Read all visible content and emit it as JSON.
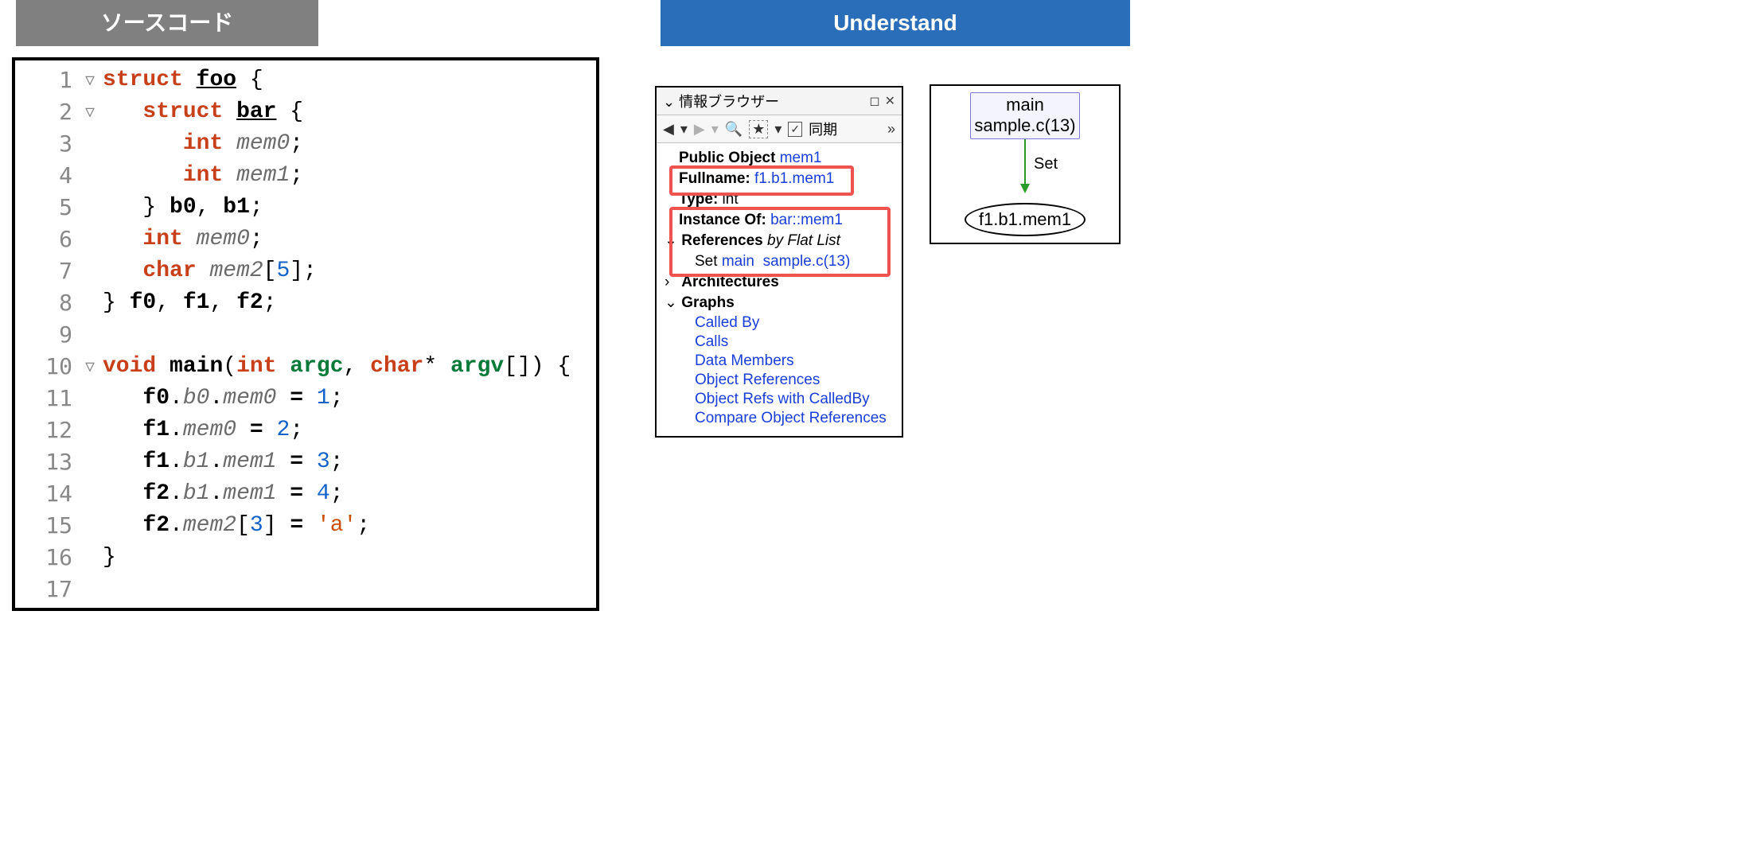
{
  "headers": {
    "source": "ソースコード",
    "understand": "Understand"
  },
  "code": {
    "lines": [
      {
        "n": 1,
        "fold": true,
        "html": "<span class='kw'>struct</span> <span class='decl'>foo</span> <span class='pn'>{</span>"
      },
      {
        "n": 2,
        "fold": true,
        "html": "   <span class='kw'>struct</span> <span class='decl'>bar</span> <span class='pn'>{</span>"
      },
      {
        "n": 3,
        "fold": false,
        "html": "      <span class='kw'>int</span> <span class='mem'>mem0</span><span class='pn'>;</span>"
      },
      {
        "n": 4,
        "fold": false,
        "html": "      <span class='kw'>int</span> <span class='mem'>mem1</span><span class='pn'>;</span>"
      },
      {
        "n": 5,
        "fold": false,
        "html": "   <span class='pn'>}</span> <span class='id'>b0</span><span class='pn'>,</span> <span class='id'>b1</span><span class='pn'>;</span>"
      },
      {
        "n": 6,
        "fold": false,
        "html": "   <span class='kw'>int</span> <span class='mem'>mem0</span><span class='pn'>;</span>"
      },
      {
        "n": 7,
        "fold": false,
        "html": "   <span class='kw'>char</span> <span class='mem'>mem2</span><span class='pn'>[</span><span class='num'>5</span><span class='pn'>];</span>"
      },
      {
        "n": 8,
        "fold": false,
        "html": "<span class='pn'>}</span> <span class='id'>f0</span><span class='pn'>,</span> <span class='id'>f1</span><span class='pn'>,</span> <span class='id'>f2</span><span class='pn'>;</span>"
      },
      {
        "n": 9,
        "fold": false,
        "html": ""
      },
      {
        "n": 10,
        "fold": true,
        "html": "<span class='kw'>void</span> <span class='fn'>main</span><span class='pn'>(</span><span class='kw'>int</span> <span class='type'>argc</span><span class='pn'>,</span> <span class='kw'>char</span><span class='pn'>*</span> <span class='type'>argv</span><span class='pn'>[]) {</span>"
      },
      {
        "n": 11,
        "fold": false,
        "html": "   <span class='id'>f0</span><span class='pn'>.</span><span class='mem'>b0</span><span class='pn'>.</span><span class='mem'>mem0</span> <span class='op'>=</span> <span class='num'>1</span><span class='pn'>;</span>"
      },
      {
        "n": 12,
        "fold": false,
        "html": "   <span class='id'>f1</span><span class='pn'>.</span><span class='mem'>mem0</span> <span class='op'>=</span> <span class='num'>2</span><span class='pn'>;</span>"
      },
      {
        "n": 13,
        "fold": false,
        "html": "   <span class='id'>f1</span><span class='pn'>.</span><span class='mem'>b1</span><span class='pn'>.</span><span class='mem'>mem1</span> <span class='op'>=</span> <span class='num'>3</span><span class='pn'>;</span>"
      },
      {
        "n": 14,
        "fold": false,
        "html": "   <span class='id'>f2</span><span class='pn'>.</span><span class='mem'>b1</span><span class='pn'>.</span><span class='mem'>mem1</span> <span class='op'>=</span> <span class='num'>4</span><span class='pn'>;</span>"
      },
      {
        "n": 15,
        "fold": false,
        "html": "   <span class='id'>f2</span><span class='pn'>.</span><span class='mem'>mem2</span><span class='pn'>[</span><span class='num'>3</span><span class='pn'>]</span> <span class='op'>=</span> <span class='chr'>'a'</span><span class='pn'>;</span>"
      },
      {
        "n": 16,
        "fold": false,
        "html": "<span class='pn'>}</span>"
      },
      {
        "n": 17,
        "fold": false,
        "html": ""
      }
    ]
  },
  "info": {
    "title": "情報ブラウザー",
    "sync_label": "同期",
    "public_object_label": "Public Object",
    "public_object_value": "mem1",
    "fullname_label": "Fullname",
    "fullname_value": "f1.b1.mem1",
    "type_label": "Type",
    "type_value": "int",
    "instanceof_label": "Instance Of",
    "instanceof_value": "bar::mem1",
    "references_label": "References",
    "references_mode": "by Flat List",
    "ref_set_label": "Set",
    "ref_set_func": "main",
    "ref_set_loc": "sample.c(13)",
    "architectures_label": "Architectures",
    "graphs_label": "Graphs",
    "graph_items": [
      "Called By",
      "Calls",
      "Data Members",
      "Object References",
      "Object Refs with CalledBy",
      "Compare Object References"
    ]
  },
  "graph": {
    "caller_name": "main",
    "caller_loc": "sample.c(13)",
    "edge_label": "Set",
    "target": "f1.b1.mem1"
  }
}
